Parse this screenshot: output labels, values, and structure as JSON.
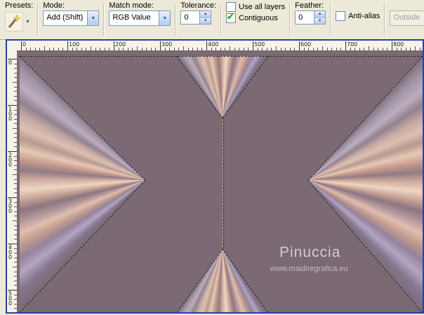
{
  "toolbar": {
    "presets_label": "Presets:",
    "mode": {
      "label": "Mode:",
      "value": "Add (Shift)"
    },
    "match_mode": {
      "label": "Match mode:",
      "value": "RGB Value"
    },
    "tolerance": {
      "label": "Tolerance:",
      "value": "0"
    },
    "use_all_layers": {
      "label": "Use all layers",
      "checked": false
    },
    "contiguous": {
      "label": "Contiguous",
      "checked": true
    },
    "feather": {
      "label": "Feather:",
      "value": "0"
    },
    "anti_alias": {
      "label": "Anti-alias",
      "checked": false
    },
    "outside": {
      "value": "Outside",
      "disabled": true
    }
  },
  "rulers": {
    "horizontal_labels": [
      "0",
      "100",
      "200",
      "300",
      "400",
      "500",
      "600",
      "700",
      "800"
    ],
    "vertical_labels": [
      "0",
      "100",
      "200",
      "300",
      "400",
      "500"
    ]
  },
  "canvas": {
    "background": "#7b6974",
    "center_line_color": "#c08a6d",
    "selection_dash_color": "#2a2a2a",
    "stripe_palette": [
      "#7a6b78",
      "#a195a8",
      "#bcadbe",
      "#92828f",
      "#c7aaa4",
      "#dcc0b2",
      "#b79a90",
      "#e6c8b6",
      "#c59a8b",
      "#917b85",
      "#d2ad9e",
      "#eed6c4",
      "#c9a496",
      "#8d7680",
      "#b2969b",
      "#dfbfb0",
      "#c09a8e",
      "#95839a",
      "#b3a5c1",
      "#85778e",
      "#7a6b78"
    ],
    "watermark": {
      "title": "Pinuccia",
      "url": "www.maidiregrafica.eu"
    }
  }
}
